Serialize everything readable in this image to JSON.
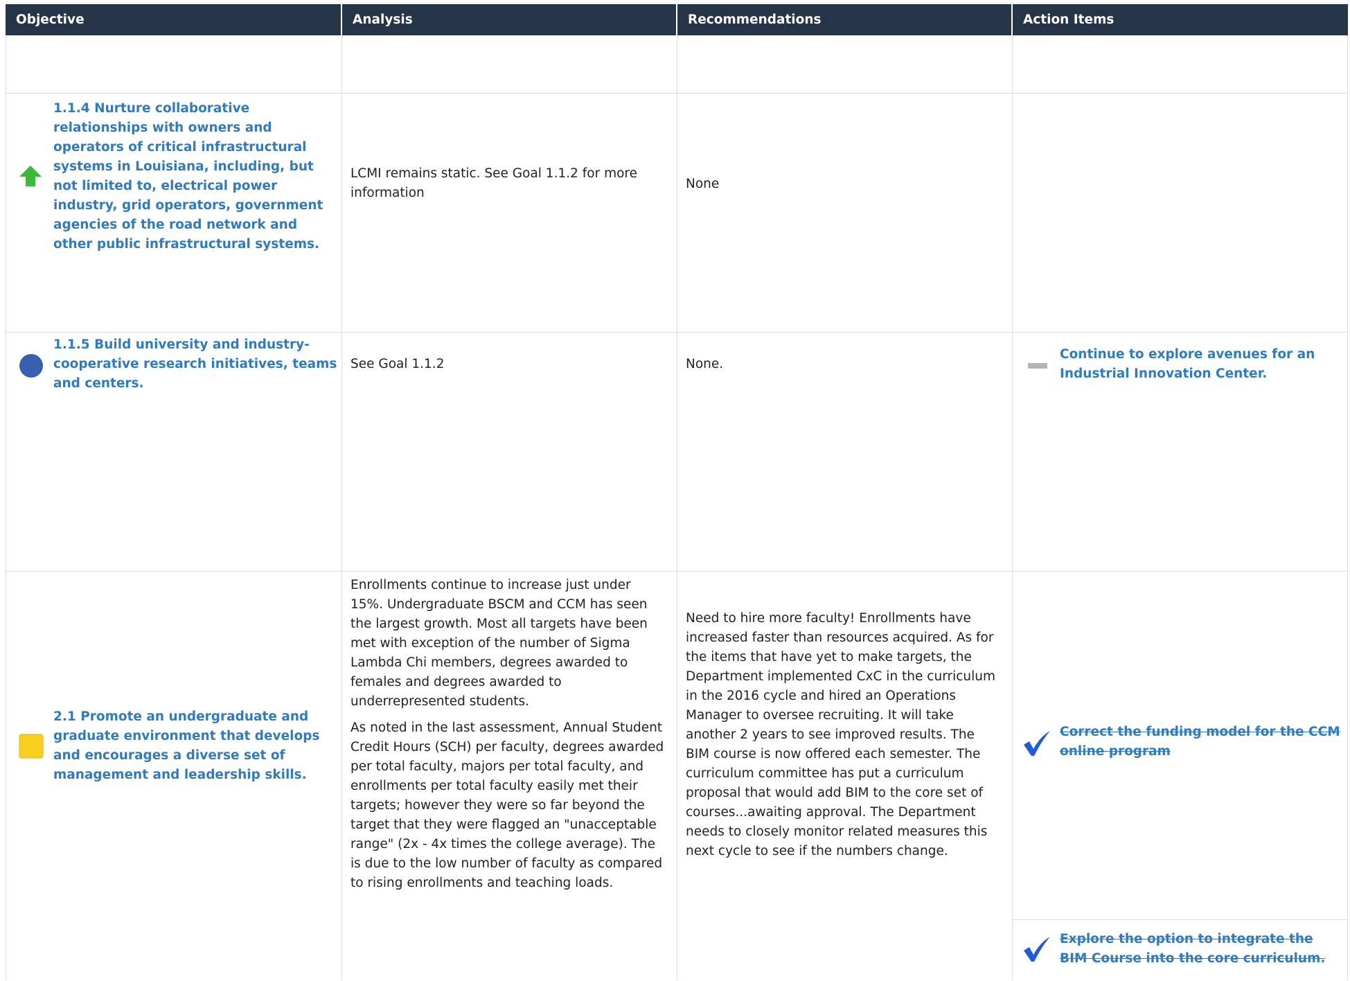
{
  "header": {
    "objective": "Objective",
    "analysis": "Analysis",
    "recommendations": "Recommendations",
    "action_items": "Action Items"
  },
  "rows": [
    {
      "objective": "1.1.4 Nurture collaborative relationships with owners and operators of critical infrastructural systems in Louisiana, including, but not limited to, electrical power industry, grid operators, government agencies of the road network and other public infrastructural systems.",
      "status_icon": "green-up-arrow-icon",
      "analysis": "LCMI remains static.  See Goal 1.1.2 for more information",
      "recommendations": "None"
    },
    {
      "objective": "1.1.5 Build university and industry-cooperative research initiatives, teams and centers.",
      "status_icon": "blue-circle-icon",
      "analysis": "See Goal 1.1.2",
      "recommendations": "None.",
      "action_item": "Continue to explore avenues for an Industrial Innovation Center.",
      "action_icon": "gray-dash-icon"
    },
    {
      "objective": "2.1 Promote an undergraduate and graduate environment that develops and encourages a diverse set of management and leadership skills.",
      "status_icon": "yellow-square-icon",
      "analysis_p1": "Enrollments continue to increase just under 15%.   Undergraduate BSCM and CCM has seen the largest growth.  Most all targets have been met with exception of the number of Sigma Lambda Chi members, degrees awarded to females and degrees awarded to underrepresented students.",
      "analysis_p2": "As noted in the last assessment, Annual Student Credit Hours (SCH) per faculty, degrees awarded per total faculty, majors per total faculty, and enrollments per total faculty easily met their targets; however they were so far beyond the target that they were flagged an \"unacceptable range\" (2x - 4x times the college average).  The is due to the low number of faculty as compared to rising enrollments and teaching loads.",
      "recommendations": "Need to hire more faculty!  Enrollments have increased faster than resources acquired. As for the items that have yet to make targets, the Department implemented CxC in the curriculum in the 2016 cycle and hired an Operations Manager to oversee recruiting.  It will take another 2 years to see improved results. The BIM course is now offered each semester.  The curriculum committee has put a curriculum proposal that would add BIM to the core set of courses...awaiting approval.  The Department needs to closely monitor related measures this next cycle to see if the numbers change.",
      "action_item_1": "Correct the funding model for the CCM online program",
      "action_item_2": "Explore the option to integrate the BIM Course into the core curriculum.",
      "action_icon": "blue-checkmark-icon"
    }
  ],
  "colors": {
    "header_bg": "#253447",
    "link": "#2f7bbd",
    "green": "#3cb83c",
    "blue_circle": "#3660b0",
    "yellow": "#f9cf1f",
    "gray_dash": "#b4b4b4",
    "check_blue": "#1f5bd6"
  }
}
